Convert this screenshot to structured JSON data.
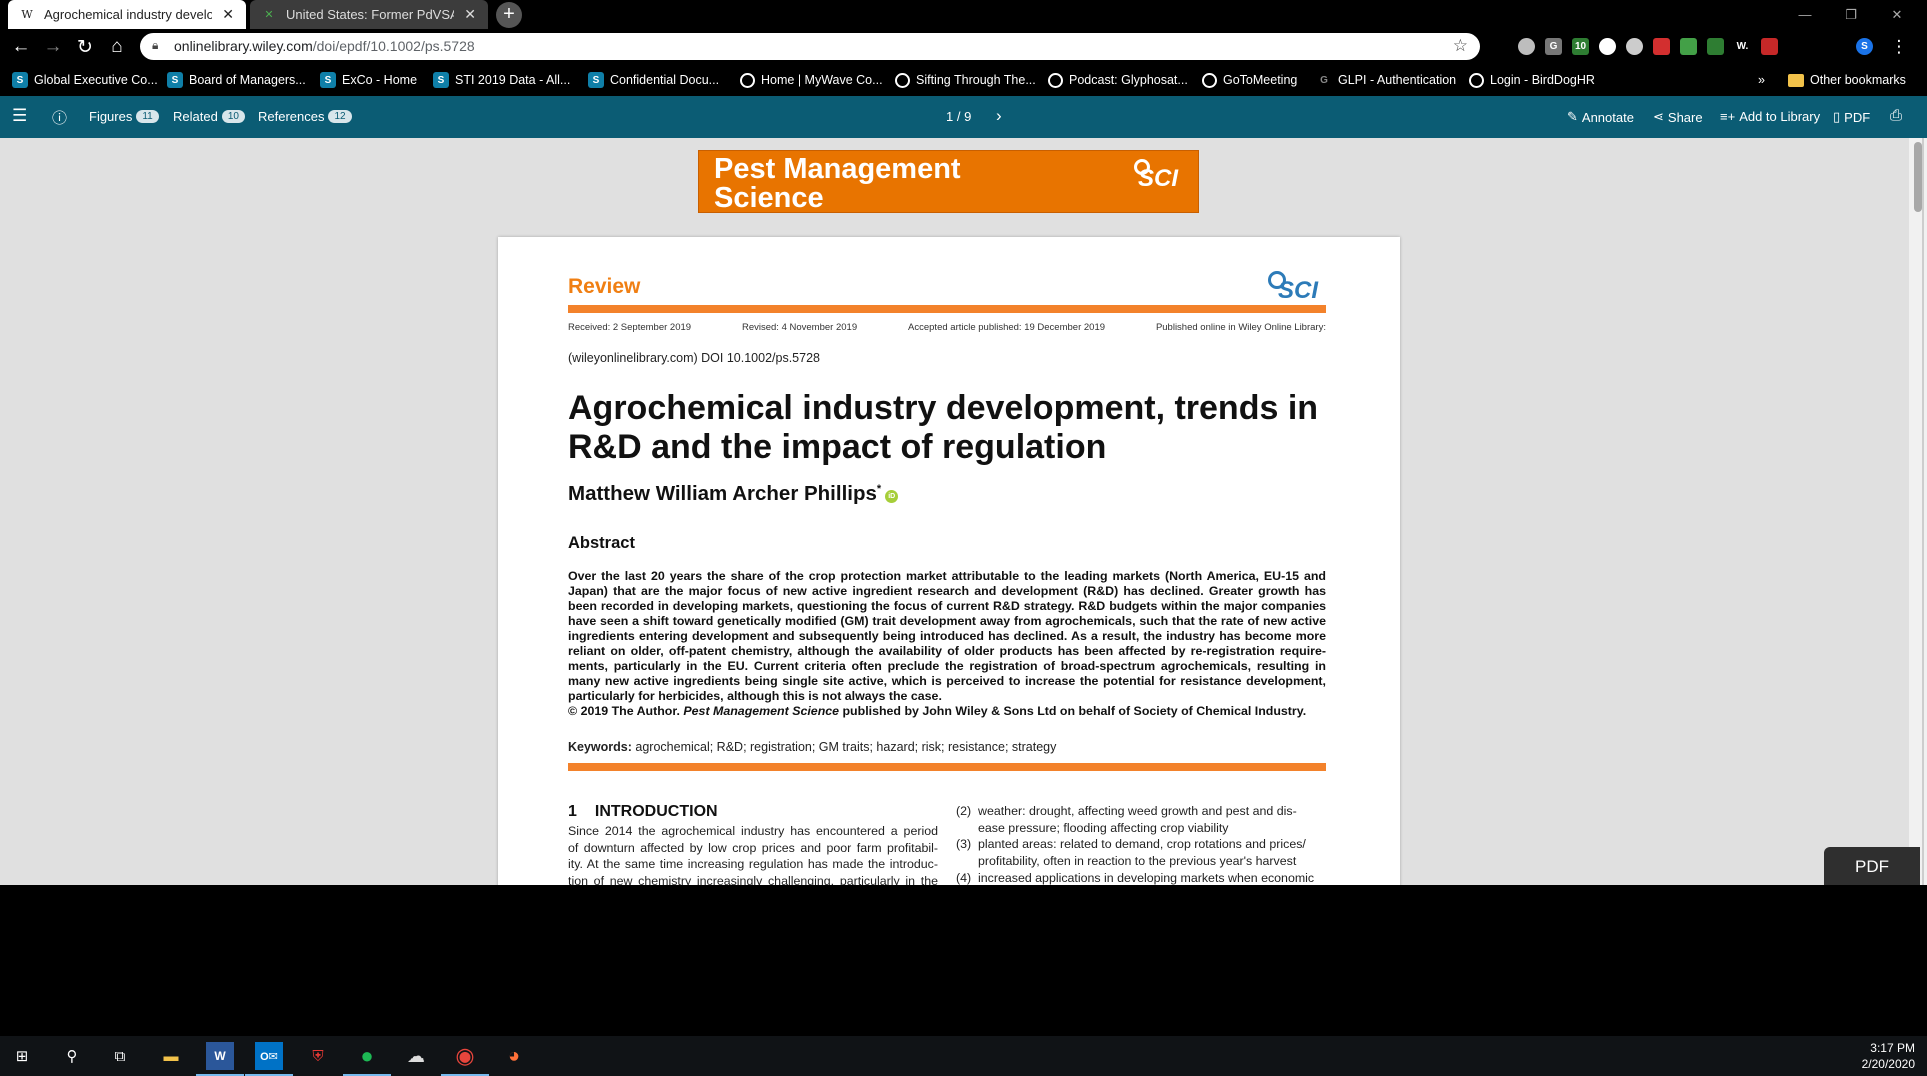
{
  "browser": {
    "tabs": [
      {
        "favicon": "W",
        "title": "Agrochemical industry developm",
        "active": true
      },
      {
        "favicon": "✕",
        "title": "United States: Former PdVSA Pro",
        "active": false
      }
    ],
    "new_tab": "+",
    "url_host": "onlinelibrary.wiley.com",
    "url_path": "/doi/epdf/10.1002/ps.5728",
    "window_controls": {
      "minimize": "—",
      "restore": "❐",
      "close": "✕"
    },
    "extensions": [
      {
        "label": "",
        "color": "#bdbdbd"
      },
      {
        "label": "G",
        "color": "#777777"
      },
      {
        "label": "10",
        "color": "#2e7d32"
      },
      {
        "label": "",
        "color": "#ffffff"
      },
      {
        "label": "",
        "color": "#cccccc"
      },
      {
        "label": "",
        "color": "#d32f2f"
      },
      {
        "label": "",
        "color": "#43a047"
      },
      {
        "label": "",
        "color": "#2e7d32"
      },
      {
        "label": "W.",
        "color": "#000000"
      },
      {
        "label": "",
        "color": "#c62828"
      },
      {
        "label": "S",
        "color": "#1a73e8"
      }
    ]
  },
  "bookmarks": {
    "items": [
      {
        "icon": "S",
        "type": "sp",
        "label": "Global Executive Co..."
      },
      {
        "icon": "S",
        "type": "sp",
        "label": "Board of Managers..."
      },
      {
        "icon": "S",
        "type": "sp",
        "label": "ExCo - Home"
      },
      {
        "icon": "S",
        "type": "sp",
        "label": "STI 2019 Data - All..."
      },
      {
        "icon": "S",
        "type": "sp",
        "label": "Confidential Docu..."
      },
      {
        "icon": "",
        "type": "glb",
        "label": "Home | MyWave Co..."
      },
      {
        "icon": "",
        "type": "glb",
        "label": "Sifting Through The..."
      },
      {
        "icon": "",
        "type": "glb",
        "label": "Podcast: Glyphosat..."
      },
      {
        "icon": "",
        "type": "glb",
        "label": "GoToMeeting"
      },
      {
        "icon": "G",
        "type": "gl",
        "label": "GLPI - Authentication"
      },
      {
        "icon": "",
        "type": "glb",
        "label": "Login - BirdDogHR"
      }
    ],
    "more": "»",
    "other": "Other bookmarks"
  },
  "viewer": {
    "menu_icon": "☰",
    "info_icon": "ⓘ",
    "figures_label": "Figures",
    "figures_count": "11",
    "related_label": "Related",
    "related_count": "10",
    "references_label": "References",
    "references_count": "12",
    "page_indicator": "1 / 9",
    "next_page": "›",
    "annotate": "Annotate",
    "share": "Share",
    "add_to_library": "Add to Library",
    "pdf": "PDF",
    "pdf_float": "PDF"
  },
  "paper": {
    "journal_line1": "Pest Management",
    "journal_line2": "Science",
    "sci": "SCI",
    "section": "Review",
    "received": "Received: 2 September 2019",
    "revised": "Revised: 4 November 2019",
    "accepted": "Accepted article published: 19 December 2019",
    "published": "Published online in Wiley Online Library:",
    "doi_line": "(wileyonlinelibrary.com) DOI 10.1002/ps.5728",
    "title_line1": "Agrochemical industry development, trends in",
    "title_line2": "R&D and the impact of regulation",
    "author": "Matthew William Archer Phillips",
    "author_mark": "*",
    "orcid": "iD",
    "abstract_heading": "Abstract",
    "abstract_lines": [
      "Over the last 20 years the share of the crop protection market attributable to the leading markets (North America, EU-15 and",
      "Japan) that are the major focus of new active ingredient research and development (R&D) has declined. Greater growth has",
      "been recorded in developing markets, questioning the focus of current R&D strategy. R&D budgets within the major companies",
      "have seen a shift toward genetically modified (GM) trait development away from agrochemicals, such that the rate of new active",
      "ingredients entering development and subsequently being introduced has declined. As a result, the industry has become more",
      "reliant on older, off-patent chemistry, although the availability of older products has been affected by re-registration require-",
      "ments, particularly in the EU. Current criteria often preclude the registration of broad-spectrum agrochemicals, resulting in",
      "many new active ingredients being single site active, which is perceived to increase the potential for resistance development,",
      "particularly for herbicides, although this is not always the case."
    ],
    "copyright_a": "© 2019 The Author. ",
    "copyright_journal": "Pest Management Science",
    "copyright_b": " published by John Wiley & Sons Ltd on behalf of Society of Chemical Industry.",
    "keywords_label": "Keywords:",
    "keywords": "agrochemical; R&D; registration; GM traits; hazard; risk; resistance; strategy",
    "intro_number": "1",
    "intro_heading": "INTRODUCTION",
    "intro_lines": [
      "Since 2014 the agrochemical industry has encountered a period",
      "of downturn affected by low crop prices and poor farm profitabil-",
      "ity. At the same time increasing regulation has made the introduc-",
      "tion of new chemistry increasingly challenging, particularly in the"
    ],
    "list_items": [
      {
        "n": "(2)",
        "lines": [
          "weather: drought, affecting weed growth and pest and dis-",
          "ease pressure; flooding affecting crop viability"
        ]
      },
      {
        "n": "(3)",
        "lines": [
          "planted areas: related to demand, crop rotations and prices/",
          "profitability, often in reaction to the previous year's harvest"
        ]
      },
      {
        "n": "(4)",
        "lines": [
          "increased applications in developing markets when economic"
        ]
      }
    ]
  },
  "taskbar": {
    "time": "3:17 PM",
    "date": "2/20/2020",
    "apps": [
      "start",
      "search",
      "task-view",
      "file-explorer",
      "word",
      "outlook",
      "security",
      "spotify",
      "cloud",
      "chrome",
      "firefox"
    ]
  }
}
